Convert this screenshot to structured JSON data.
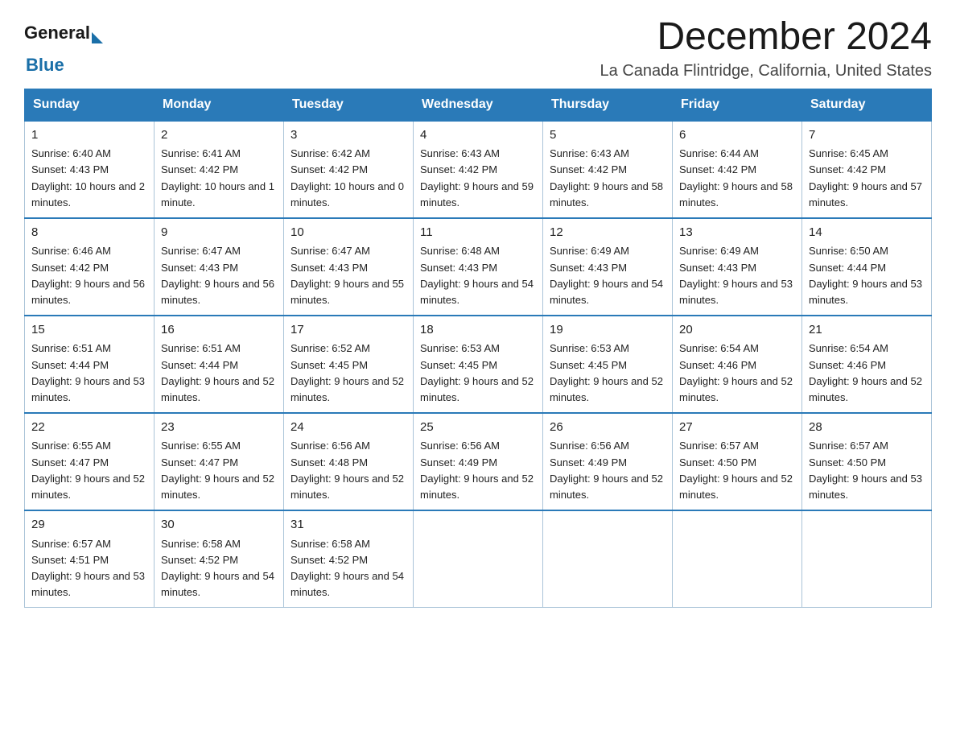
{
  "header": {
    "logo_general": "General",
    "logo_blue": "Blue",
    "month_title": "December 2024",
    "location": "La Canada Flintridge, California, United States"
  },
  "days_of_week": [
    "Sunday",
    "Monday",
    "Tuesday",
    "Wednesday",
    "Thursday",
    "Friday",
    "Saturday"
  ],
  "weeks": [
    [
      {
        "day": "1",
        "sunrise": "6:40 AM",
        "sunset": "4:43 PM",
        "daylight": "10 hours and 2 minutes."
      },
      {
        "day": "2",
        "sunrise": "6:41 AM",
        "sunset": "4:42 PM",
        "daylight": "10 hours and 1 minute."
      },
      {
        "day": "3",
        "sunrise": "6:42 AM",
        "sunset": "4:42 PM",
        "daylight": "10 hours and 0 minutes."
      },
      {
        "day": "4",
        "sunrise": "6:43 AM",
        "sunset": "4:42 PM",
        "daylight": "9 hours and 59 minutes."
      },
      {
        "day": "5",
        "sunrise": "6:43 AM",
        "sunset": "4:42 PM",
        "daylight": "9 hours and 58 minutes."
      },
      {
        "day": "6",
        "sunrise": "6:44 AM",
        "sunset": "4:42 PM",
        "daylight": "9 hours and 58 minutes."
      },
      {
        "day": "7",
        "sunrise": "6:45 AM",
        "sunset": "4:42 PM",
        "daylight": "9 hours and 57 minutes."
      }
    ],
    [
      {
        "day": "8",
        "sunrise": "6:46 AM",
        "sunset": "4:42 PM",
        "daylight": "9 hours and 56 minutes."
      },
      {
        "day": "9",
        "sunrise": "6:47 AM",
        "sunset": "4:43 PM",
        "daylight": "9 hours and 56 minutes."
      },
      {
        "day": "10",
        "sunrise": "6:47 AM",
        "sunset": "4:43 PM",
        "daylight": "9 hours and 55 minutes."
      },
      {
        "day": "11",
        "sunrise": "6:48 AM",
        "sunset": "4:43 PM",
        "daylight": "9 hours and 54 minutes."
      },
      {
        "day": "12",
        "sunrise": "6:49 AM",
        "sunset": "4:43 PM",
        "daylight": "9 hours and 54 minutes."
      },
      {
        "day": "13",
        "sunrise": "6:49 AM",
        "sunset": "4:43 PM",
        "daylight": "9 hours and 53 minutes."
      },
      {
        "day": "14",
        "sunrise": "6:50 AM",
        "sunset": "4:44 PM",
        "daylight": "9 hours and 53 minutes."
      }
    ],
    [
      {
        "day": "15",
        "sunrise": "6:51 AM",
        "sunset": "4:44 PM",
        "daylight": "9 hours and 53 minutes."
      },
      {
        "day": "16",
        "sunrise": "6:51 AM",
        "sunset": "4:44 PM",
        "daylight": "9 hours and 52 minutes."
      },
      {
        "day": "17",
        "sunrise": "6:52 AM",
        "sunset": "4:45 PM",
        "daylight": "9 hours and 52 minutes."
      },
      {
        "day": "18",
        "sunrise": "6:53 AM",
        "sunset": "4:45 PM",
        "daylight": "9 hours and 52 minutes."
      },
      {
        "day": "19",
        "sunrise": "6:53 AM",
        "sunset": "4:45 PM",
        "daylight": "9 hours and 52 minutes."
      },
      {
        "day": "20",
        "sunrise": "6:54 AM",
        "sunset": "4:46 PM",
        "daylight": "9 hours and 52 minutes."
      },
      {
        "day": "21",
        "sunrise": "6:54 AM",
        "sunset": "4:46 PM",
        "daylight": "9 hours and 52 minutes."
      }
    ],
    [
      {
        "day": "22",
        "sunrise": "6:55 AM",
        "sunset": "4:47 PM",
        "daylight": "9 hours and 52 minutes."
      },
      {
        "day": "23",
        "sunrise": "6:55 AM",
        "sunset": "4:47 PM",
        "daylight": "9 hours and 52 minutes."
      },
      {
        "day": "24",
        "sunrise": "6:56 AM",
        "sunset": "4:48 PM",
        "daylight": "9 hours and 52 minutes."
      },
      {
        "day": "25",
        "sunrise": "6:56 AM",
        "sunset": "4:49 PM",
        "daylight": "9 hours and 52 minutes."
      },
      {
        "day": "26",
        "sunrise": "6:56 AM",
        "sunset": "4:49 PM",
        "daylight": "9 hours and 52 minutes."
      },
      {
        "day": "27",
        "sunrise": "6:57 AM",
        "sunset": "4:50 PM",
        "daylight": "9 hours and 52 minutes."
      },
      {
        "day": "28",
        "sunrise": "6:57 AM",
        "sunset": "4:50 PM",
        "daylight": "9 hours and 53 minutes."
      }
    ],
    [
      {
        "day": "29",
        "sunrise": "6:57 AM",
        "sunset": "4:51 PM",
        "daylight": "9 hours and 53 minutes."
      },
      {
        "day": "30",
        "sunrise": "6:58 AM",
        "sunset": "4:52 PM",
        "daylight": "9 hours and 54 minutes."
      },
      {
        "day": "31",
        "sunrise": "6:58 AM",
        "sunset": "4:52 PM",
        "daylight": "9 hours and 54 minutes."
      },
      null,
      null,
      null,
      null
    ]
  ]
}
